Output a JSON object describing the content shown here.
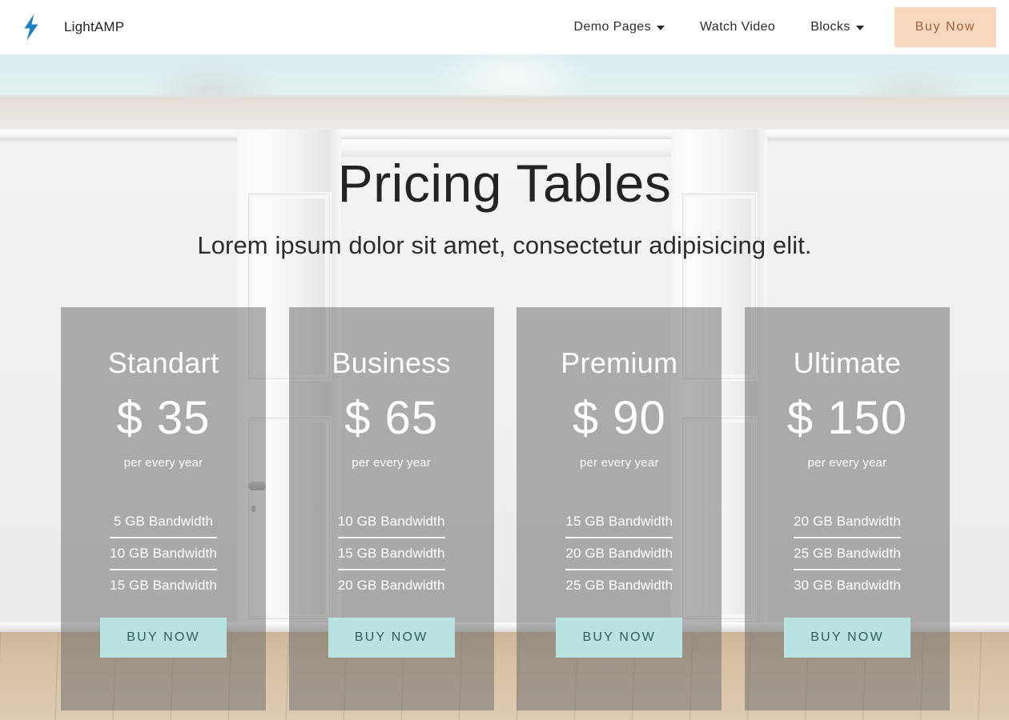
{
  "navbar": {
    "logo_icon": "lightning-bolt-icon",
    "logo_color": "#1d7fc4",
    "brand": "LightAMP",
    "links": [
      {
        "label": "Demo Pages",
        "has_dropdown": true
      },
      {
        "label": "Watch Video",
        "has_dropdown": false
      },
      {
        "label": "Blocks",
        "has_dropdown": true
      }
    ],
    "cta": {
      "label": "Buy Now",
      "background": "#f9d7bd",
      "text_color": "#9c6239"
    }
  },
  "hero": {
    "title": "Pricing Tables",
    "subtitle": "Lorem ipsum dolor sit amet, consectetur adipisicing elit.",
    "title_color": "#232323"
  },
  "pricing": {
    "card_overlay_color": "rgba(108,108,108,0.52)",
    "button_background": "#b9e3e0",
    "button_text_color": "#2f5f5d",
    "cards": [
      {
        "title": "Standart",
        "price": "$ 35",
        "period": "per every year",
        "features": [
          "5 GB Bandwidth",
          "10 GB Bandwidth",
          "15 GB Bandwidth"
        ],
        "cta": "BUY NOW"
      },
      {
        "title": "Business",
        "price": "$ 65",
        "period": "per every year",
        "features": [
          "10 GB Bandwidth",
          "15 GB Bandwidth",
          "20 GB Bandwidth"
        ],
        "cta": "BUY NOW"
      },
      {
        "title": "Premium",
        "price": "$ 90",
        "period": "per every year",
        "features": [
          "15 GB Bandwidth",
          "20 GB Bandwidth",
          "25 GB Bandwidth"
        ],
        "cta": "BUY NOW"
      },
      {
        "title": "Ultimate",
        "price": "$ 150",
        "period": "per every year",
        "features": [
          "20 GB Bandwidth",
          "25 GB Bandwidth",
          "30 GB Bandwidth"
        ],
        "cta": "BUY NOW"
      }
    ]
  }
}
